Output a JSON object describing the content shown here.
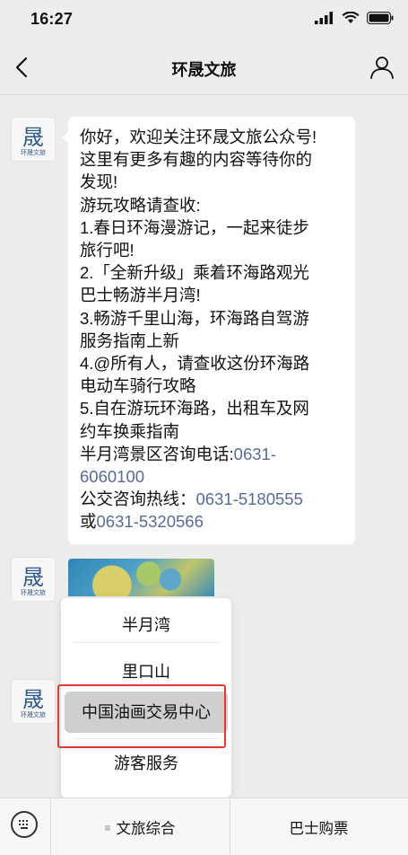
{
  "status": {
    "time": "16:27"
  },
  "nav": {
    "title": "环晟文旅"
  },
  "welcome": {
    "lines": [
      "你好，欢迎关注环晟文旅公众号!",
      "这里有更多有趣的内容等待你的",
      "发现!",
      "游玩攻略请查收:",
      "1.春日环海漫游记，一起来徒步",
      "旅行吧!",
      "2.「全新升级」乘着环海路观光",
      "巴士畅游半月湾!",
      "3.畅游千里山海，环海路自驾游",
      "服务指南上新",
      "4.@所有人，请查收这份环海路",
      "电动车骑行攻略",
      "5.自在游玩环海路，出租车及网",
      "约车换乘指南"
    ],
    "bay_phone_label": "半月湾景区咨询电话:",
    "bay_phone_part1": "0631-",
    "bay_phone_part2": "6060100",
    "bus_phone_label": "公交咨询热线：",
    "bus_phone_1": "0631-5180555",
    "or_label": "或",
    "bus_phone_2": "0631-5320566"
  },
  "avatar_logo": {
    "symbol": "晟",
    "caption": "环晟文旅"
  },
  "popup_menu": {
    "items": [
      "半月湾",
      "里口山",
      "中国油画交易中心",
      "游客服务"
    ],
    "selected_index": 2
  },
  "bottom_bar": {
    "menu_1": "文旅综合",
    "menu_2": "巴士购票"
  },
  "colors": {
    "link": "#576b95",
    "highlight": "#e53935",
    "background": "#ededed"
  }
}
